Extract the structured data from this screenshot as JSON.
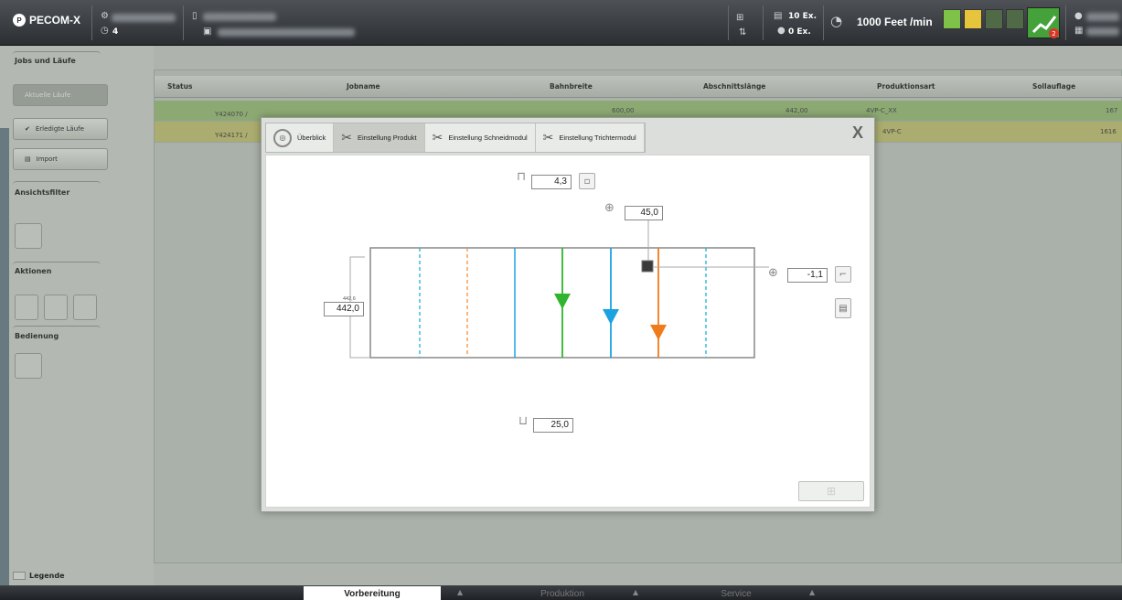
{
  "topbar": {
    "logo": "PECOM-X",
    "counter_value": "4",
    "copies_top": "10 Ex.",
    "copies_bottom": "0 Ex.",
    "speed": "1000 Feet /min",
    "badge": "2"
  },
  "sidebar": {
    "jobs_header": "Jobs und Läufe",
    "btn_active": "Aktuelle Läufe",
    "btn_done": "Erledigte Läufe",
    "btn_import": "Import",
    "view_filter_header": "Ansichtsfilter",
    "actions_header": "Aktionen",
    "operation_header": "Bedienung",
    "legend": "Legende"
  },
  "table": {
    "headers": [
      "Status",
      "Jobname",
      "Bahnbreite",
      "Abschnittslänge",
      "Produktionsart",
      "Sollauflage"
    ],
    "rows": [
      {
        "id": "Y424070 /",
        "width": "600,00",
        "length": "442,00",
        "type": "4VP-C_XX",
        "qty": "167"
      },
      {
        "id": "Y424171 /",
        "width": "",
        "length": "",
        "type": "4VP-C",
        "qty": "1616"
      }
    ]
  },
  "modal": {
    "tabs": [
      {
        "label": "Überblick",
        "icon": "overview-icon"
      },
      {
        "label": "Einstellung Produkt",
        "icon": "product-settings-icon"
      },
      {
        "label": "Einstellung Schneidmodul",
        "icon": "cutting-module-icon"
      },
      {
        "label": "Einstellung Trichtermodul",
        "icon": "funnel-module-icon"
      }
    ],
    "close": "X",
    "fields": {
      "top_width": "4,3",
      "offset_top": "45,0",
      "offset_right": "-1,1",
      "length_hint": "442,6",
      "length": "442,0",
      "bottom": "25,0"
    }
  },
  "bottom_tabs": [
    "Vorbereitung",
    "Produktion",
    "Service"
  ],
  "colors": {
    "green_line": "#2db52d",
    "blue_line": "#1aa3e0",
    "orange_line": "#f07b1a",
    "cyan_dashed": "#1fb0d9",
    "orange_dashed": "#f3913a"
  }
}
